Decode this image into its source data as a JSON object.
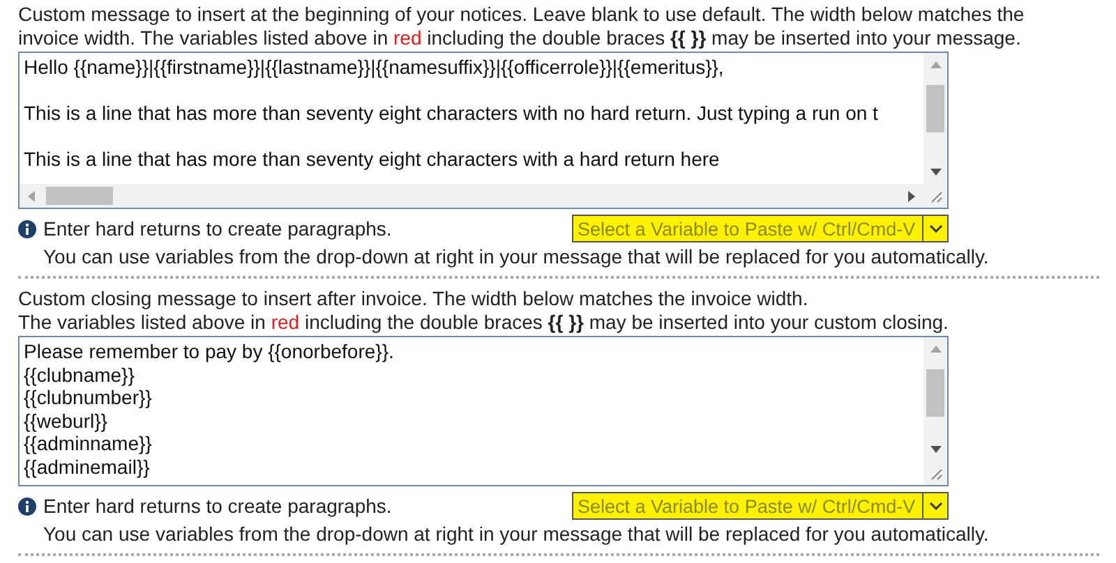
{
  "sections": [
    {
      "intro_lines": [
        [
          {
            "kind": "plain",
            "text": "Custom message to insert at the beginning of your notices. Leave blank to use default. The width below matches the invoice width. The variables listed above in "
          },
          {
            "kind": "red",
            "text": "red"
          },
          {
            "kind": "plain",
            "text": " including the double braces **{{ }}** may be inserted into your message."
          }
        ]
      ],
      "field": {
        "lines": [
          {
            "text": "Hello {{name}}|{{firstname}}|{{lastname}}|{{namesuffix}}|{{officerrole}}|{{emeritus}},",
            "blank_line_before": false
          },
          {
            "text": "This is a line that has more than seventy eight characters with no hard return. Just typing a run on t",
            "blank_line_before": true
          },
          {
            "text": "This is a line that has more than seventy eight characters with a hard return here",
            "blank_line_before": true
          }
        ],
        "horizontal_scrollbar": true
      },
      "hint": "Enter hard returns to create paragraphs.",
      "variable_select": {
        "placeholder": "Select a Variable to Paste w/ Ctrl/Cmd-V"
      },
      "note": "You can use variables from the drop-down at right in your message that will be replaced for you automatically."
    },
    {
      "intro_lines": [
        [
          {
            "kind": "plain",
            "text": "Custom closing message to insert after invoice. The width below matches the invoice width."
          }
        ],
        [
          {
            "kind": "plain",
            "text": "The variables listed above in "
          },
          {
            "kind": "red",
            "text": "red"
          },
          {
            "kind": "plain",
            "text": " including the double braces **{{ }}** may be inserted into your custom closing."
          }
        ]
      ],
      "field": {
        "lines": [
          {
            "text": "Please remember to pay by {{onorbefore}}.",
            "blank_line_before": false
          },
          {
            "text": "{{clubname}}",
            "blank_line_before": false
          },
          {
            "text": "{{clubnumber}}",
            "blank_line_before": false
          },
          {
            "text": "{{weburl}}",
            "blank_line_before": false
          },
          {
            "text": "{{adminname}}",
            "blank_line_before": false
          },
          {
            "text": "{{adminemail}}",
            "blank_line_before": false
          }
        ],
        "horizontal_scrollbar": false
      },
      "hint": "Enter hard returns to create paragraphs.",
      "variable_select": {
        "placeholder": "Select a Variable to Paste w/ Ctrl/Cmd-V"
      },
      "note": "You can use variables from the drop-down at right in your message that will be replaced for you automatically."
    }
  ]
}
